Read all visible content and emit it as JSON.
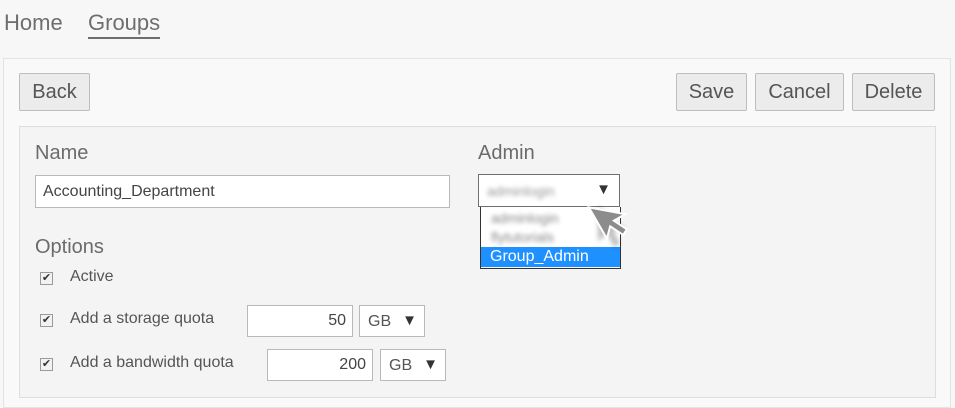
{
  "nav": {
    "home": "Home",
    "groups": "Groups"
  },
  "toolbar": {
    "back": "Back",
    "save": "Save",
    "cancel": "Cancel",
    "delete": "Delete"
  },
  "form": {
    "name_label": "Name",
    "name_value": "Accounting_Department",
    "admin_label": "Admin",
    "admin_selected": "adminlogin",
    "admin_options": [
      "adminlogin",
      "flytutorials",
      "Group_Admin"
    ],
    "options_label": "Options",
    "active_label": "Active",
    "storage_label": "Add a storage quota",
    "storage_value": "50",
    "storage_unit": "GB",
    "bandwidth_label": "Add a bandwidth quota",
    "bandwidth_value": "200",
    "bandwidth_unit": "GB"
  },
  "icons": {
    "caret": "▼",
    "check": "✔"
  },
  "colors": {
    "highlight": "#1e90ff",
    "background": "#f7f7f7"
  }
}
